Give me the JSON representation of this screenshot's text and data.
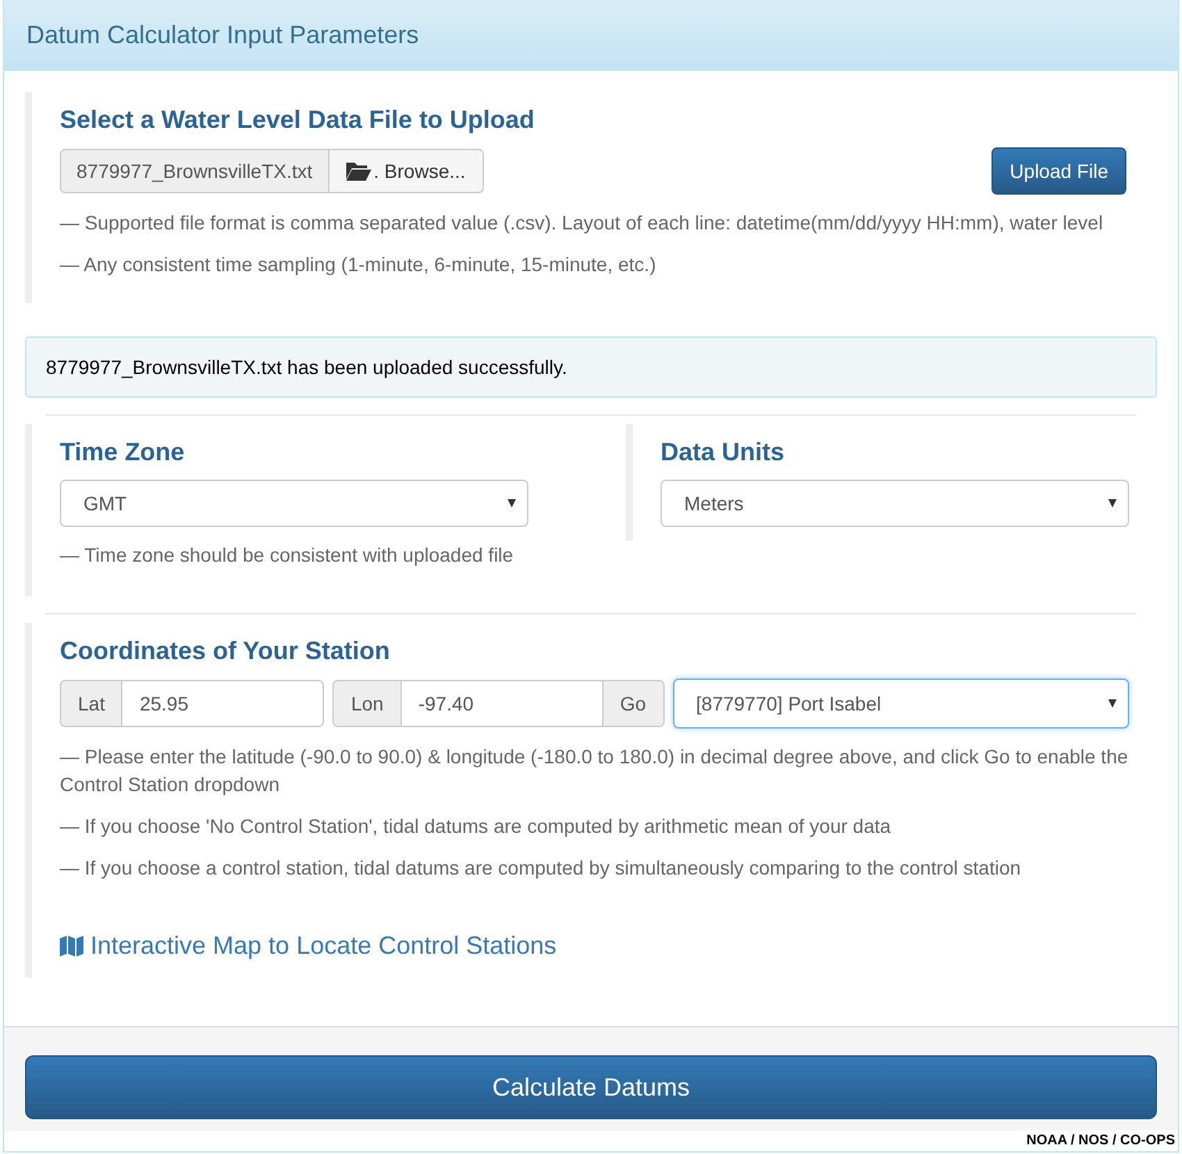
{
  "panel": {
    "title": "Datum Calculator Input Parameters"
  },
  "upload": {
    "heading": "Select a Water Level Data File to Upload",
    "file_name": "8779977_BrownsvilleTX.txt",
    "browse_label": ". Browse...",
    "upload_button": "Upload File",
    "notes": [
      "— Supported file format is comma separated value (.csv). Layout of each line: datetime(mm/dd/yyyy HH:mm), water level",
      "— Any consistent time sampling (1-minute, 6-minute, 15-minute, etc.)"
    ]
  },
  "alert": {
    "message": "8779977_BrownsvilleTX.txt has been uploaded successfully."
  },
  "time_zone": {
    "heading": "Time Zone",
    "value": "GMT",
    "note": "— Time zone should be consistent with uploaded file"
  },
  "data_units": {
    "heading": "Data Units",
    "value": "Meters"
  },
  "coordinates": {
    "heading": "Coordinates of Your Station",
    "lat_label": "Lat",
    "lat_value": "25.95",
    "lon_label": "Lon",
    "lon_value": "-97.40",
    "go_button": "Go",
    "station": {
      "value": "[8779770] Port Isabel",
      "focused": true
    },
    "notes": [
      "— Please enter the latitude (-90.0 to 90.0) & longitude (-180.0 to 180.0) in decimal degree above, and click Go to enable the Control Station dropdown",
      "— If you choose 'No Control Station', tidal datums are computed by arithmetic mean of your data",
      "— If you choose a control station, tidal datums are computed by simultaneously comparing to the control station"
    ],
    "map_link": "Interactive Map to Locate Control Stations"
  },
  "calculate_button": "Calculate Datums",
  "credit": "NOAA / NOS / CO-OPS"
}
